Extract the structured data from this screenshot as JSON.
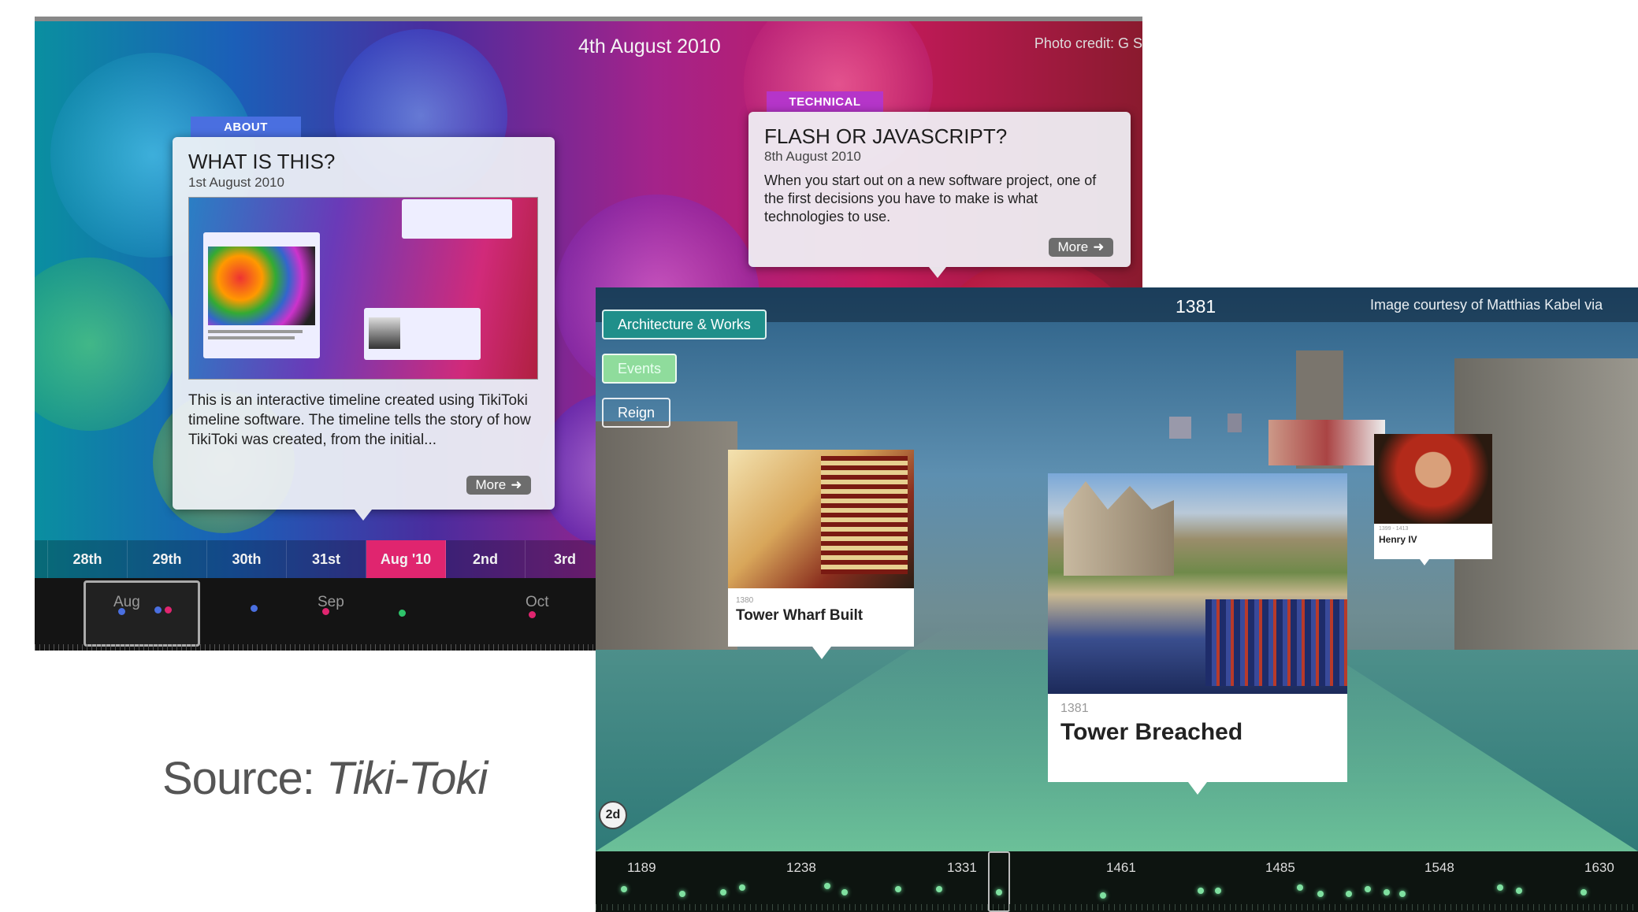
{
  "shot1": {
    "header_date": "4th August 2010",
    "photo_credit": "Photo credit: G S",
    "card_about": {
      "category": "ABOUT",
      "category_color": "#4a6fe0",
      "title": "WHAT IS THIS?",
      "date": "1st August 2010",
      "body": "This is an interactive timeline created using TikiToki timeline software. The timeline tells the story of how TikiToki was created, from the initial...",
      "more": "More"
    },
    "card_technical": {
      "category": "TECHNICAL",
      "category_color": "#b535c9",
      "title": "FLASH OR JAVASCRIPT?",
      "date": "8th August 2010",
      "body": "When you start out on a new software project, one of the first decisions you have to make is what technologies to use.",
      "more": "More"
    },
    "date_strip": [
      "28th",
      "29th",
      "30th",
      "31st",
      "Aug '10",
      "2nd",
      "3rd"
    ],
    "selected_date": "Aug '10",
    "month_labels": [
      "Aug",
      "Sep",
      "Oct"
    ],
    "accent_color": "#e0256f"
  },
  "shot2": {
    "header_year": "1381",
    "image_credit": "Image courtesy of Matthias Kabel via",
    "filters": [
      "Architecture & Works",
      "Events",
      "Reign"
    ],
    "filter_colors": [
      "#1f8f8a",
      "#8fdc9c",
      "rgba(0,0,0,0)"
    ],
    "card_wharf": {
      "year": "1380",
      "title": "Tower Wharf Built"
    },
    "card_breached": {
      "year": "1381",
      "title": "Tower Breached"
    },
    "card_henry": {
      "year": "1399 - 1413",
      "title": "Henry IV"
    },
    "view_toggle": "2d",
    "nav_years": [
      "1189",
      "1238",
      "1331",
      "1461",
      "1485",
      "1548",
      "1630"
    ]
  },
  "source": {
    "prefix": "Source: ",
    "name": "Tiki-Toki"
  }
}
